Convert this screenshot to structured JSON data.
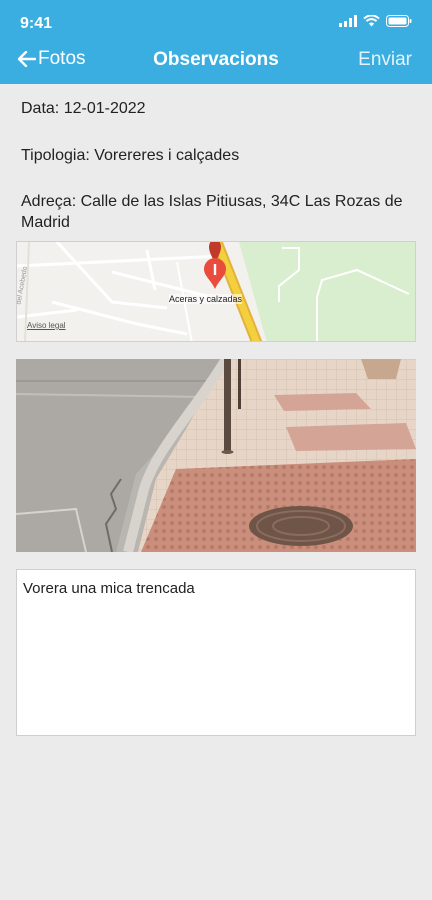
{
  "status": {
    "time": "9:41"
  },
  "nav": {
    "back_label": "Fotos",
    "title": "Observacions",
    "send_label": "Enviar"
  },
  "fields": {
    "date": "Data: 12-01-2022",
    "type": "Tipologia: Vorereres i calçades",
    "address": "Adreça: Calle de las Islas Pitiusas, 34C Las Rozas de Madrid"
  },
  "map": {
    "pin_label": "Aceras y calzadas",
    "legal_link": "Aviso legal",
    "street_label": "del Acebedo"
  },
  "notes": {
    "text": "Vorera una mica trencada"
  },
  "colors": {
    "header": "#3aaee0",
    "pin": "#e94b3c",
    "road": "#f4d03f"
  }
}
